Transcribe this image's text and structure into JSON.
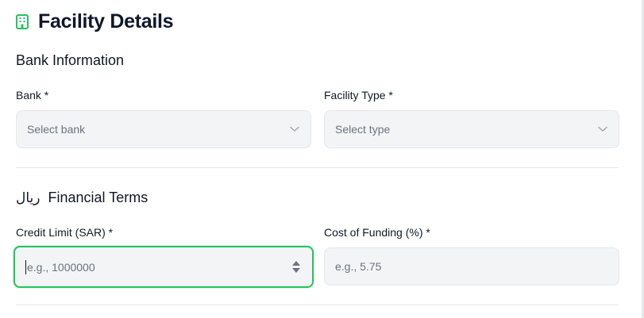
{
  "header": {
    "title": "Facility Details",
    "icon": "building-icon",
    "accent_color": "#22c55e"
  },
  "bank_section": {
    "title": "Bank Information",
    "bank": {
      "label": "Bank *",
      "placeholder": "Select bank"
    },
    "facility_type": {
      "label": "Facility Type *",
      "placeholder": "Select type"
    }
  },
  "financial_section": {
    "currency_symbol": "ريال",
    "title": "Financial Terms",
    "credit_limit": {
      "label": "Credit Limit (SAR) *",
      "placeholder": "e.g., 1000000"
    },
    "cost_of_funding": {
      "label": "Cost of Funding (%) *",
      "placeholder": "e.g., 5.75"
    }
  }
}
